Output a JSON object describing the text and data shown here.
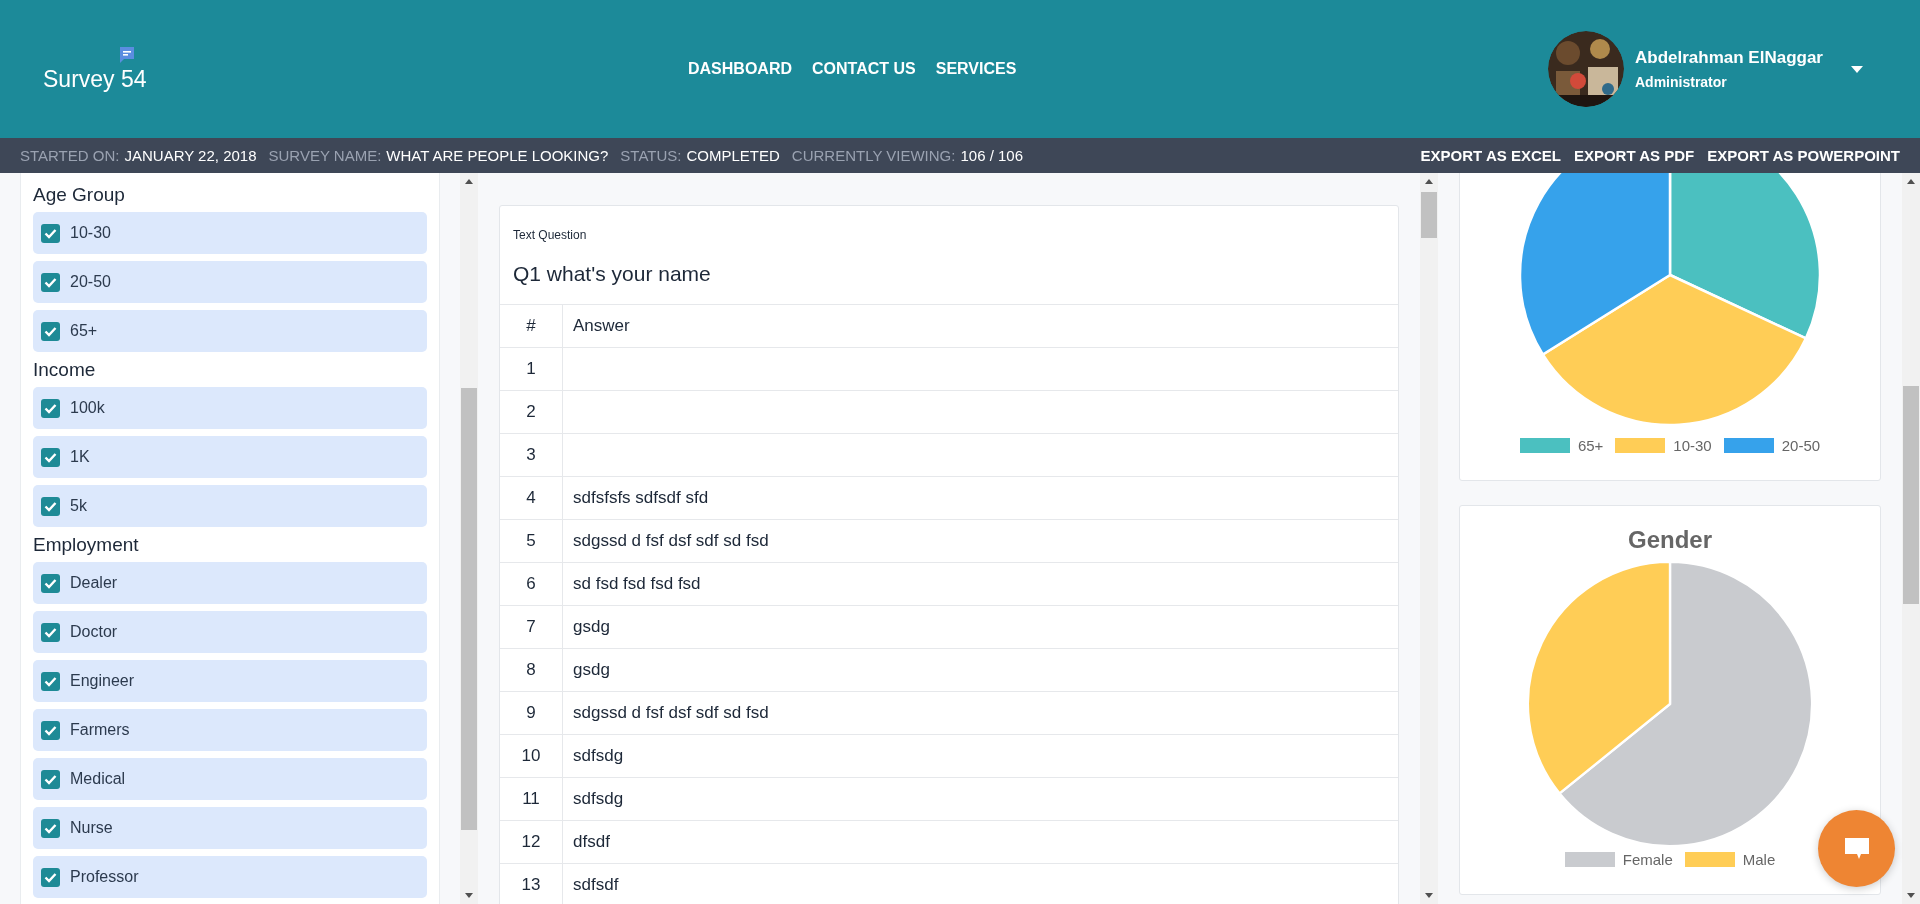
{
  "header": {
    "logo": "Survey 54",
    "nav": [
      "DASHBOARD",
      "CONTACT US",
      "SERVICES"
    ],
    "user": {
      "name": "Abdelrahman ElNaggar",
      "role": "Administrator"
    }
  },
  "status_bar": {
    "fields": [
      {
        "label": "STARTED ON:",
        "value": "JANUARY 22, 2018"
      },
      {
        "label": "SURVEY NAME:",
        "value": "WHAT ARE PEOPLE LOOKING?"
      },
      {
        "label": "STATUS:",
        "value": "COMPLETED"
      },
      {
        "label": "CURRENTLY VIEWING:",
        "value": "106 / 106"
      }
    ],
    "exports": [
      "EXPORT AS EXCEL",
      "EXPORT AS PDF",
      "EXPORT AS POWERPOINT"
    ]
  },
  "filters": [
    {
      "heading": "Age Group",
      "options": [
        {
          "label": "10-30",
          "checked": true
        },
        {
          "label": "20-50",
          "checked": true
        },
        {
          "label": "65+",
          "checked": true
        }
      ]
    },
    {
      "heading": "Income",
      "options": [
        {
          "label": "100k",
          "checked": true
        },
        {
          "label": "1K",
          "checked": true
        },
        {
          "label": "5k",
          "checked": true
        }
      ]
    },
    {
      "heading": "Employment",
      "options": [
        {
          "label": "Dealer",
          "checked": true
        },
        {
          "label": "Doctor",
          "checked": true
        },
        {
          "label": "Engineer",
          "checked": true
        },
        {
          "label": "Farmers",
          "checked": true
        },
        {
          "label": "Medical",
          "checked": true
        },
        {
          "label": "Nurse",
          "checked": true
        },
        {
          "label": "Professor",
          "checked": true
        }
      ]
    }
  ],
  "question": {
    "type_label": "Text Question",
    "title": "Q1 what's your name",
    "columns": [
      "#",
      "Answer"
    ],
    "rows": [
      {
        "number": "1"
      },
      {
        "number": "2"
      },
      {
        "number": "3"
      },
      {
        "number": "4",
        "answer": "sdfsfsfs sdfsdf sfd"
      },
      {
        "number": "5",
        "answer": "sdgssd d fsf dsf sdf sd fsd"
      },
      {
        "number": "6",
        "answer": "sd fsd fsd fsd fsd"
      },
      {
        "number": "7",
        "answer": "gsdg"
      },
      {
        "number": "8",
        "answer": "gsdg"
      },
      {
        "number": "9",
        "answer": "sdgssd d fsf dsf sdf sd fsd"
      },
      {
        "number": "10",
        "answer": "sdfsdg"
      },
      {
        "number": "11",
        "answer": "sdfsdg"
      },
      {
        "number": "12",
        "answer": "dfsdf"
      },
      {
        "number": "13",
        "answer": "sdfsdf"
      }
    ]
  },
  "charts": [
    {
      "legend": [
        {
          "label": "65+",
          "color": "#4bc0c0"
        },
        {
          "label": "10-30",
          "color": "#ffcd56"
        },
        {
          "label": "20-50",
          "color": "#36a2eb"
        }
      ]
    },
    {
      "title": "Gender",
      "legend": [
        {
          "label": "Female",
          "color": "#c9cbcf"
        },
        {
          "label": "Male",
          "color": "#ffcd56"
        }
      ]
    }
  ]
}
